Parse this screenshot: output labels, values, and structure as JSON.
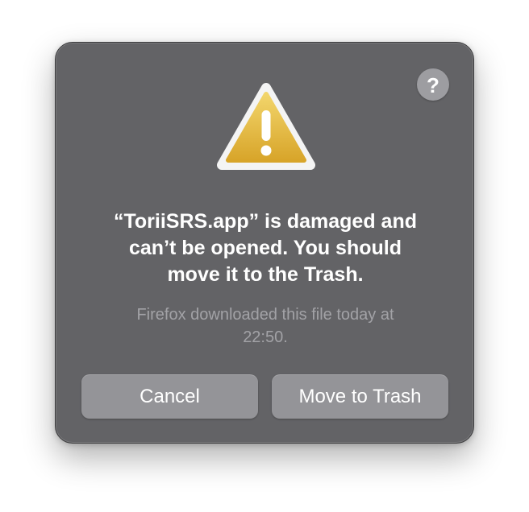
{
  "dialog": {
    "help_glyph": "?",
    "help_icon": "question-mark-icon",
    "warning_icon": "warning-triangle-icon",
    "title": "“ToriiSRS.app” is damaged and\ncan’t be opened. You should\nmove it to the Trash.",
    "message": "Firefox downloaded this file today at\n22:50.",
    "buttons": {
      "cancel_label": "Cancel",
      "move_to_trash_label": "Move to Trash"
    }
  },
  "colors": {
    "panel_background": "#636366",
    "button_background": "#949498",
    "warning_gradient_top": "#f2d56b",
    "warning_gradient_bottom": "#d8a52a",
    "title_text": "#ffffff",
    "message_text": "#a2a2a6"
  }
}
